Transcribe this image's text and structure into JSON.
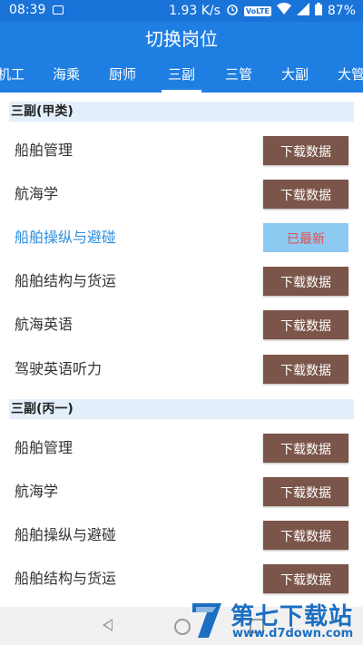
{
  "status_bar": {
    "time": "08:39",
    "network_speed": "1.93 K/s",
    "volte": "VoLTE",
    "battery": "87%",
    "icons": [
      "image-icon",
      "alarm-icon",
      "wifi-icon",
      "signal-icon",
      "battery-icon"
    ]
  },
  "app_bar": {
    "title": "切换岗位"
  },
  "tabs": {
    "items": [
      {
        "label": "机工"
      },
      {
        "label": "海乘"
      },
      {
        "label": "厨师"
      },
      {
        "label": "三副"
      },
      {
        "label": "三管"
      },
      {
        "label": "大副"
      },
      {
        "label": "大管"
      }
    ],
    "active_index": 3
  },
  "sections": [
    {
      "title": "三副(甲类)",
      "items": [
        {
          "label": "船舶管理",
          "button": "下载数据"
        },
        {
          "label": "航海学",
          "button": "下载数据"
        },
        {
          "label": "船舶操纵与避碰",
          "button": "已最新"
        },
        {
          "label": "船舶结构与货运",
          "button": "下载数据"
        },
        {
          "label": "航海英语",
          "button": "下载数据"
        },
        {
          "label": "驾驶英语听力",
          "button": "下载数据"
        }
      ]
    },
    {
      "title": "三副(丙一)",
      "items": [
        {
          "label": "船舶管理",
          "button": "下载数据"
        },
        {
          "label": "航海学",
          "button": "下载数据"
        },
        {
          "label": "船舶操纵与避碰",
          "button": "下载数据"
        },
        {
          "label": "船舶结构与货运",
          "button": "下载数据"
        }
      ]
    }
  ],
  "watermark": {
    "title": "第七下载站",
    "url": "www.d7down.com"
  },
  "colors": {
    "primary": "#1f7ee2",
    "download_button": "#7b5549",
    "latest_button": "#8ccaf2",
    "latest_text": "#ea4a4a",
    "highlight_text": "#2f8fe0",
    "section_bg": "#e3f0fb"
  }
}
